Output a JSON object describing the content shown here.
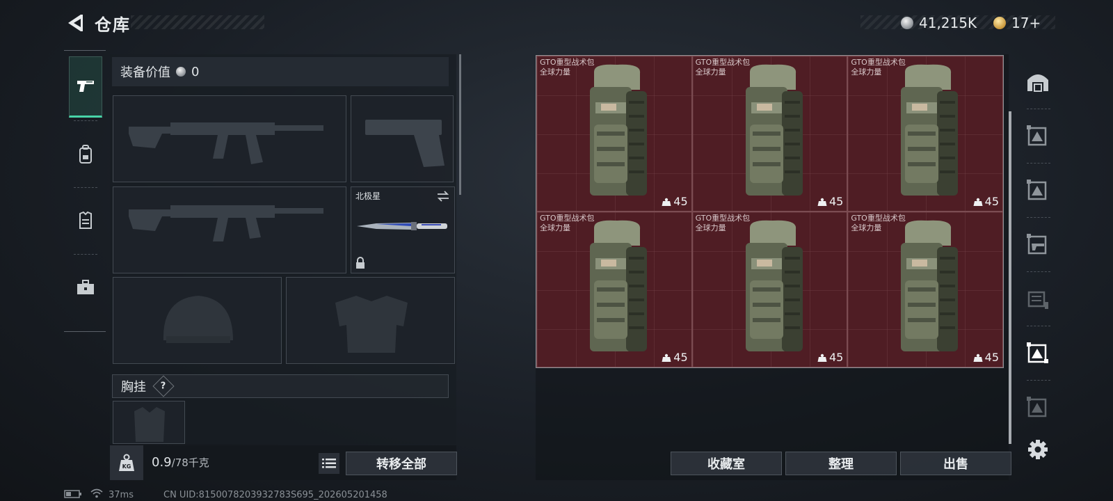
{
  "header": {
    "title": "仓库"
  },
  "currency": {
    "silver": "41,215K",
    "gold": "17+"
  },
  "loadout": {
    "value_label": "装备价值",
    "value": "0",
    "melee_name": "北极星",
    "chest_label": "胸挂",
    "chest_hint": "?"
  },
  "weight": {
    "current": "0.9",
    "max": "/78千克",
    "kg_icon_label": "KG"
  },
  "buttons": {
    "transfer_all": "转移全部",
    "collection": "收藏室",
    "organize": "整理",
    "sell": "出售"
  },
  "storage": {
    "items": [
      {
        "name_line1": "GTO重型战术包",
        "name_line2": "全球力量",
        "quantity": "45"
      },
      {
        "name_line1": "GTO重型战术包",
        "name_line2": "全球力量",
        "quantity": "45"
      },
      {
        "name_line1": "GTO重型战术包",
        "name_line2": "全球力量",
        "quantity": "45"
      },
      {
        "name_line1": "GTO重型战术包",
        "name_line2": "全球力量",
        "quantity": "45"
      },
      {
        "name_line1": "GTO重型战术包",
        "name_line2": "全球力量",
        "quantity": "45"
      },
      {
        "name_line1": "GTO重型战术包",
        "name_line2": "全球力量",
        "quantity": "45"
      }
    ]
  },
  "status": {
    "ping": "37ms",
    "uid": "CN UID:8150078203932783S695_202605201458"
  },
  "colors": {
    "accent": "#48d4a8",
    "item_cell": "#4f1d24"
  },
  "icons": {
    "left_tabs": [
      "pistol-icon",
      "backpack-icon",
      "vest-icon",
      "toolbox-icon"
    ],
    "right_tabs": [
      "safe-icon",
      "storage-expansion-icon",
      "storage-expansion-icon",
      "weapon-storage-icon",
      "rack-icon",
      "storage-expansion-icon",
      "storage-expansion-icon",
      "settings-icon"
    ]
  }
}
